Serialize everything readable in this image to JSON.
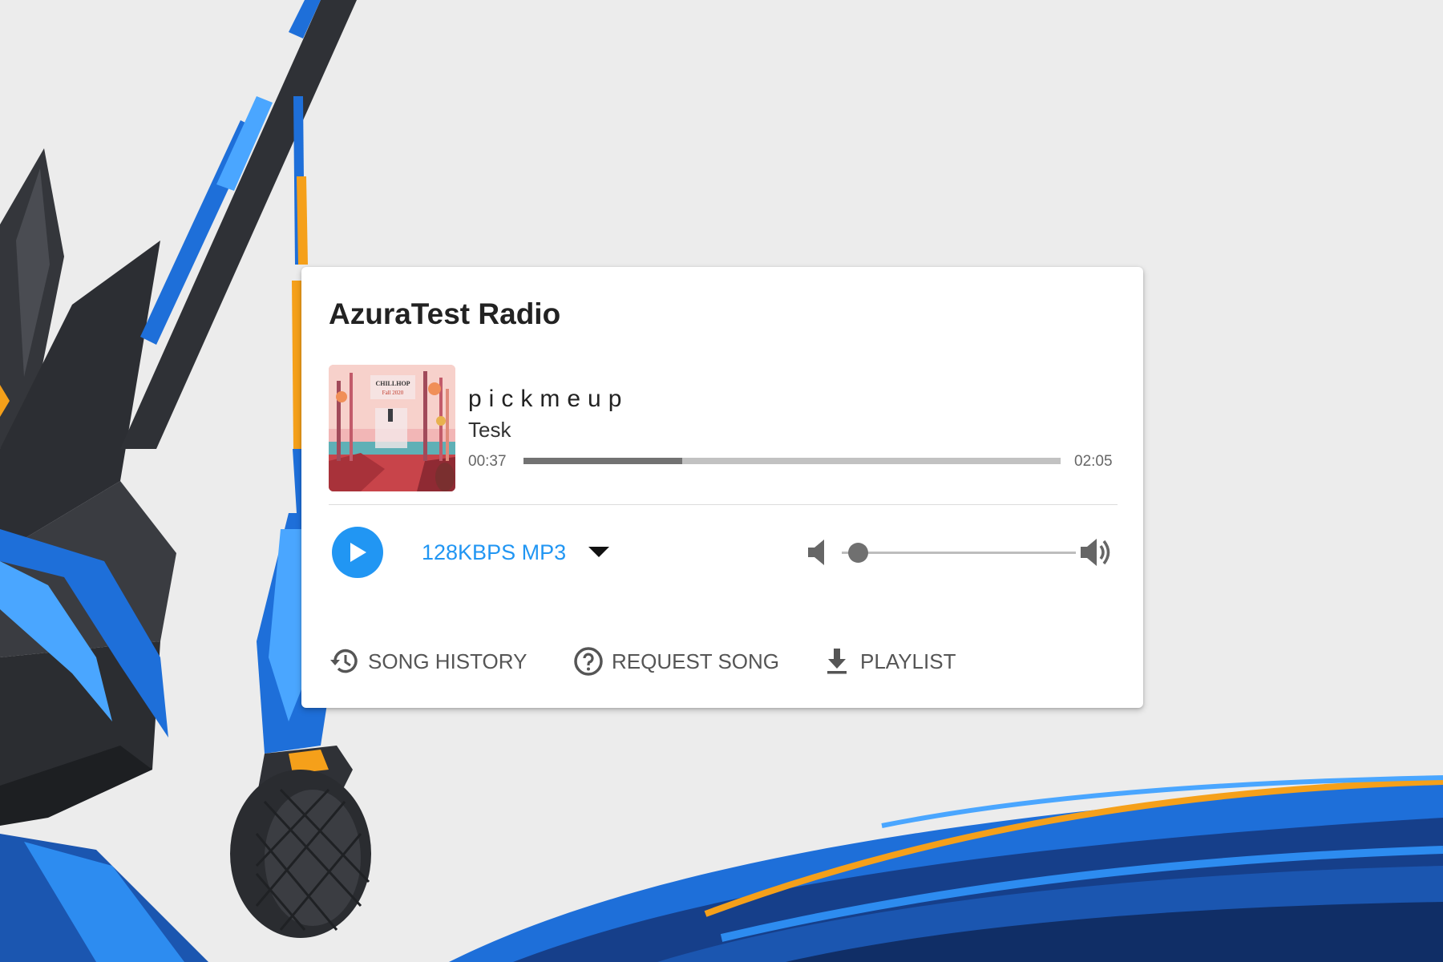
{
  "station": {
    "name": "AzuraTest Radio"
  },
  "now_playing": {
    "title": "pickmeup",
    "artist": "Tesk",
    "elapsed": "00:37",
    "duration": "02:05",
    "progress_fraction": 0.296,
    "album_art": {
      "icon": "album-art-image",
      "label_line1": "CHILLHOP",
      "label_line2": "Fall 2020"
    }
  },
  "controls": {
    "play_icon": "play-icon",
    "stream_label": "128KBPS MP3",
    "stream_caret_icon": "caret-down-icon",
    "mute_icon": "volume-off-icon",
    "volume_fraction": 0.07,
    "volume_full_icon": "volume-up-icon"
  },
  "actions": [
    {
      "label": "SONG HISTORY",
      "icon": "history-icon"
    },
    {
      "label": "REQUEST SONG",
      "icon": "help-circle-icon"
    },
    {
      "label": "PLAYLIST",
      "icon": "download-icon"
    }
  ],
  "colors": {
    "accent": "#2196f3",
    "background": "#ececec",
    "art_dark": "#2f3136",
    "art_blue": "#1e6fd9",
    "art_orange": "#f5a01a"
  }
}
